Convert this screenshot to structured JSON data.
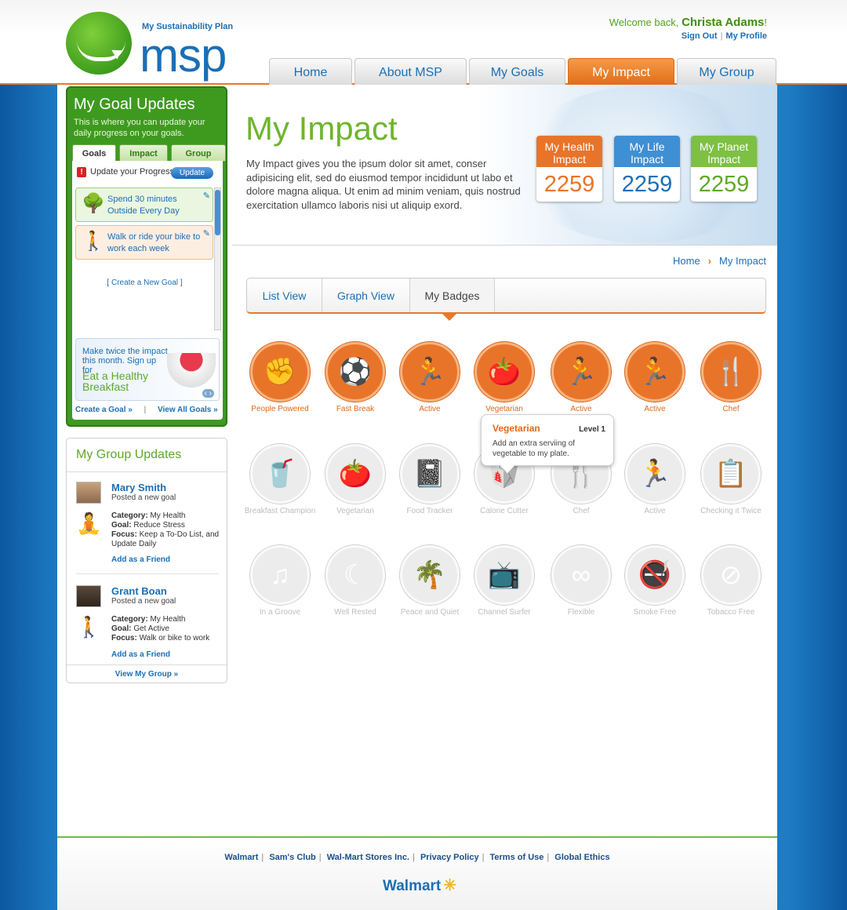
{
  "logo": {
    "tagline": "My Sustainability Plan",
    "name": "msp"
  },
  "header": {
    "welcome": "Welcome back,",
    "user": "Christa Adams",
    "bang": "!",
    "sign_out": "Sign Out",
    "sep": "|",
    "my_profile": "My Profile"
  },
  "nav": [
    {
      "label": "Home"
    },
    {
      "label": "About MSP"
    },
    {
      "label": "My Goals"
    },
    {
      "label": "My Impact",
      "active": true
    },
    {
      "label": "My Group"
    }
  ],
  "hero": {
    "title": "My Impact",
    "text": "My Impact gives you the ipsum dolor sit amet, conser adipisicing elit, sed do eiusmod tempor incididunt ut labo et dolore magna aliqua. Ut enim ad minim veniam, quis nostrud exercitation ullamco laboris nisi ut aliquip exord."
  },
  "impacts": [
    {
      "label": "My Health Impact",
      "value": "2259",
      "color": "#e8742a"
    },
    {
      "label": "My Life Impact",
      "value": "2259",
      "color": "#3f8fd4"
    },
    {
      "label": "My Planet Impact",
      "value": "2259",
      "color": "#7dc043"
    }
  ],
  "breadcrumb": {
    "home": "Home",
    "chevron": "›",
    "current": "My Impact"
  },
  "view_tabs": [
    {
      "label": "List View"
    },
    {
      "label": "Graph View"
    },
    {
      "label": "My Badges",
      "active": true
    }
  ],
  "badges_earned": [
    {
      "label": "People Powered",
      "icon": "fist-icon",
      "glyph": "✊"
    },
    {
      "label": "Fast Break",
      "icon": "basketball-icon",
      "glyph": "⚽"
    },
    {
      "label": "Active",
      "icon": "runner-icon",
      "glyph": "🏃"
    },
    {
      "label": "Vegetarian",
      "icon": "tomato-icon",
      "glyph": "🍅"
    },
    {
      "label": "Active",
      "icon": "runner-icon",
      "glyph": "🏃"
    },
    {
      "label": "Active",
      "icon": "runner-icon",
      "glyph": "🏃"
    },
    {
      "label": "Chef",
      "icon": "chef-hat-icon",
      "glyph": "🍴"
    }
  ],
  "badges_row2": [
    {
      "label": "Breakfast Champion",
      "icon": "juice-icon",
      "glyph": "🥤"
    },
    {
      "label": "Vegetarian",
      "icon": "tomato-icon",
      "glyph": "🍅"
    },
    {
      "label": "Food Tracker",
      "icon": "notebook-icon",
      "glyph": "📓"
    },
    {
      "label": "Calorie Cutter",
      "icon": "takeout-box-icon",
      "glyph": "🥡"
    },
    {
      "label": "Chef",
      "icon": "chef-hat-icon",
      "glyph": "🍴"
    },
    {
      "label": "Active",
      "icon": "runner-icon",
      "glyph": "🏃"
    },
    {
      "label": "Checking it Twice",
      "icon": "clipboard-check-icon",
      "glyph": "📋"
    }
  ],
  "badges_row3": [
    {
      "label": "In a Groove",
      "icon": "music-note-icon",
      "glyph": "♫"
    },
    {
      "label": "Well Rested",
      "icon": "moon-icon",
      "glyph": "☾"
    },
    {
      "label": "Peace and Quiet",
      "icon": "palm-tree-icon",
      "glyph": "🌴"
    },
    {
      "label": "Channel Surfer",
      "icon": "tv-icon",
      "glyph": "📺"
    },
    {
      "label": "Flexible",
      "icon": "infinity-icon",
      "glyph": "∞"
    },
    {
      "label": "Smoke Free",
      "icon": "no-smoking-icon",
      "glyph": "🚭"
    },
    {
      "label": "Tobacco Free",
      "icon": "no-tobacco-icon",
      "glyph": "⊘"
    }
  ],
  "tooltip": {
    "title": "Vegetarian",
    "level": "Level 1",
    "desc": "Add an extra serviing of vegetable to my plate."
  },
  "goal_panel": {
    "title": "My Goal Updates",
    "subtitle": "This is where you can update your daily progress on your goals.",
    "tabs": [
      {
        "label": "Goals",
        "active": true
      },
      {
        "label": "Impact"
      },
      {
        "label": "Group"
      }
    ],
    "alert_glyph": "!",
    "update_text": "Update your Progress",
    "update_button": "Update",
    "goals": [
      {
        "text": "Spend 30 minutes Outside Every Day",
        "icon": "tree-icon",
        "glyph": "🌳"
      },
      {
        "text": "Walk or ride your bike to work each week",
        "icon": "walker-icon",
        "glyph": "🚶"
      }
    ],
    "edit_glyph": "✎",
    "create_goal": "[ Create a New Goal ]",
    "promo_line1": "Make twice the impact this month. Sign up for",
    "promo_line2": "Eat a Healthy Breakfast",
    "promo_arrows": "‹ ›",
    "create_link": "Create a Goal »",
    "view_all": "View All Goals »",
    "link_sep": "|"
  },
  "group_panel": {
    "title": "My Group Updates",
    "members": [
      {
        "name": "Mary Smith",
        "action": "Posted a new goal",
        "category_label": "Category:",
        "category": "My Health",
        "goal_label": "Goal:",
        "goal": "Reduce Stress",
        "focus_label": "Focus:",
        "focus": "Keep a To-Do List, and Update Daily",
        "add_friend": "Add as a Friend",
        "icon": "meditation-icon",
        "glyph": "🧘"
      },
      {
        "name": "Grant Boan",
        "action": "Posted a new goal",
        "category_label": "Category:",
        "category": "My Health",
        "goal_label": "Goal:",
        "goal": "Get Active",
        "focus_label": "Focus:",
        "focus": "Walk or bike to work",
        "add_friend": "Add as a Friend",
        "icon": "walker-icon",
        "glyph": "🚶"
      }
    ],
    "view_group": "View My Group »"
  },
  "footer": {
    "links": [
      "Walmart",
      "Sam's Club",
      "Wal-Mart Stores Inc.",
      "Privacy Policy",
      "Terms of Use",
      "Global Ethics"
    ],
    "sep": "|",
    "brand": "Walmart",
    "spark": "✳"
  },
  "colors": {
    "orange": "#e8742a",
    "green": "#5fa828",
    "blue": "#1b6fb5"
  }
}
